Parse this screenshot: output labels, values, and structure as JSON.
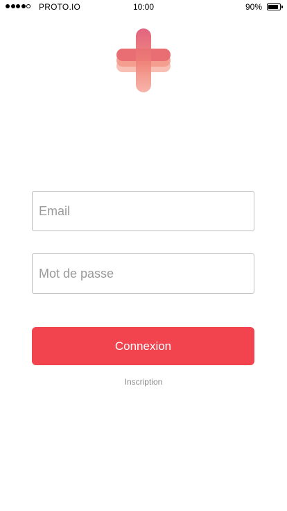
{
  "status_bar": {
    "carrier": "PROTO.IO",
    "time": "10:00",
    "battery_percent": "90%",
    "battery_level": 0.9,
    "signal_bars_filled": 4,
    "signal_bars_total": 5
  },
  "logo": {
    "icon": "plus-cross-logo-icon",
    "colors": {
      "top": "#e05c78",
      "middle": "#f0857a",
      "bottom": "#f7b0a6"
    }
  },
  "form": {
    "email": {
      "placeholder": "Email",
      "value": ""
    },
    "password": {
      "placeholder": "Mot de passe",
      "value": ""
    },
    "login_label": "Connexion",
    "signup_label": "Inscription"
  },
  "colors": {
    "accent": "#f1444e",
    "field_border": "#bfbfbf",
    "placeholder": "#9a9a9a",
    "link": "#8a8a8a"
  }
}
